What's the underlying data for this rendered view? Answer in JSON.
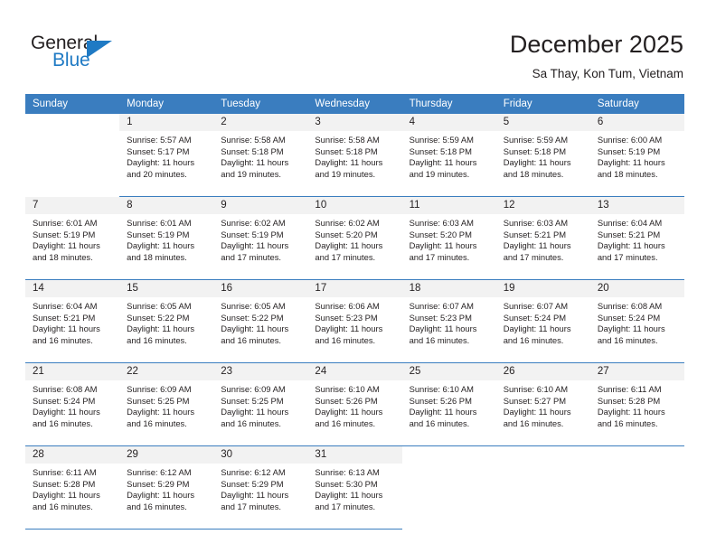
{
  "brand": {
    "name_top": "General",
    "name_bottom": "Blue",
    "accent_color": "#1f7ac4",
    "text_color": "#231f20"
  },
  "header": {
    "title": "December 2025",
    "subtitle": "Sa Thay, Kon Tum, Vietnam"
  },
  "theme": {
    "header_row_bg": "#3a7dbf",
    "daynum_bg": "#f2f2f2",
    "cell_bg": "#ffffff",
    "separator": "#3a7dbf"
  },
  "weekdays": [
    "Sunday",
    "Monday",
    "Tuesday",
    "Wednesday",
    "Thursday",
    "Friday",
    "Saturday"
  ],
  "weeks": [
    {
      "days": [
        {
          "date": "",
          "sunrise": "",
          "sunset": "",
          "daylight_line1": "",
          "daylight_line2": "",
          "empty": true
        },
        {
          "date": "1",
          "sunrise": "Sunrise: 5:57 AM",
          "sunset": "Sunset: 5:17 PM",
          "daylight_line1": "Daylight: 11 hours",
          "daylight_line2": "and 20 minutes.",
          "empty": false
        },
        {
          "date": "2",
          "sunrise": "Sunrise: 5:58 AM",
          "sunset": "Sunset: 5:18 PM",
          "daylight_line1": "Daylight: 11 hours",
          "daylight_line2": "and 19 minutes.",
          "empty": false
        },
        {
          "date": "3",
          "sunrise": "Sunrise: 5:58 AM",
          "sunset": "Sunset: 5:18 PM",
          "daylight_line1": "Daylight: 11 hours",
          "daylight_line2": "and 19 minutes.",
          "empty": false
        },
        {
          "date": "4",
          "sunrise": "Sunrise: 5:59 AM",
          "sunset": "Sunset: 5:18 PM",
          "daylight_line1": "Daylight: 11 hours",
          "daylight_line2": "and 19 minutes.",
          "empty": false
        },
        {
          "date": "5",
          "sunrise": "Sunrise: 5:59 AM",
          "sunset": "Sunset: 5:18 PM",
          "daylight_line1": "Daylight: 11 hours",
          "daylight_line2": "and 18 minutes.",
          "empty": false
        },
        {
          "date": "6",
          "sunrise": "Sunrise: 6:00 AM",
          "sunset": "Sunset: 5:19 PM",
          "daylight_line1": "Daylight: 11 hours",
          "daylight_line2": "and 18 minutes.",
          "empty": false
        }
      ]
    },
    {
      "days": [
        {
          "date": "7",
          "sunrise": "Sunrise: 6:01 AM",
          "sunset": "Sunset: 5:19 PM",
          "daylight_line1": "Daylight: 11 hours",
          "daylight_line2": "and 18 minutes.",
          "empty": false
        },
        {
          "date": "8",
          "sunrise": "Sunrise: 6:01 AM",
          "sunset": "Sunset: 5:19 PM",
          "daylight_line1": "Daylight: 11 hours",
          "daylight_line2": "and 18 minutes.",
          "empty": false
        },
        {
          "date": "9",
          "sunrise": "Sunrise: 6:02 AM",
          "sunset": "Sunset: 5:19 PM",
          "daylight_line1": "Daylight: 11 hours",
          "daylight_line2": "and 17 minutes.",
          "empty": false
        },
        {
          "date": "10",
          "sunrise": "Sunrise: 6:02 AM",
          "sunset": "Sunset: 5:20 PM",
          "daylight_line1": "Daylight: 11 hours",
          "daylight_line2": "and 17 minutes.",
          "empty": false
        },
        {
          "date": "11",
          "sunrise": "Sunrise: 6:03 AM",
          "sunset": "Sunset: 5:20 PM",
          "daylight_line1": "Daylight: 11 hours",
          "daylight_line2": "and 17 minutes.",
          "empty": false
        },
        {
          "date": "12",
          "sunrise": "Sunrise: 6:03 AM",
          "sunset": "Sunset: 5:21 PM",
          "daylight_line1": "Daylight: 11 hours",
          "daylight_line2": "and 17 minutes.",
          "empty": false
        },
        {
          "date": "13",
          "sunrise": "Sunrise: 6:04 AM",
          "sunset": "Sunset: 5:21 PM",
          "daylight_line1": "Daylight: 11 hours",
          "daylight_line2": "and 17 minutes.",
          "empty": false
        }
      ]
    },
    {
      "days": [
        {
          "date": "14",
          "sunrise": "Sunrise: 6:04 AM",
          "sunset": "Sunset: 5:21 PM",
          "daylight_line1": "Daylight: 11 hours",
          "daylight_line2": "and 16 minutes.",
          "empty": false
        },
        {
          "date": "15",
          "sunrise": "Sunrise: 6:05 AM",
          "sunset": "Sunset: 5:22 PM",
          "daylight_line1": "Daylight: 11 hours",
          "daylight_line2": "and 16 minutes.",
          "empty": false
        },
        {
          "date": "16",
          "sunrise": "Sunrise: 6:05 AM",
          "sunset": "Sunset: 5:22 PM",
          "daylight_line1": "Daylight: 11 hours",
          "daylight_line2": "and 16 minutes.",
          "empty": false
        },
        {
          "date": "17",
          "sunrise": "Sunrise: 6:06 AM",
          "sunset": "Sunset: 5:23 PM",
          "daylight_line1": "Daylight: 11 hours",
          "daylight_line2": "and 16 minutes.",
          "empty": false
        },
        {
          "date": "18",
          "sunrise": "Sunrise: 6:07 AM",
          "sunset": "Sunset: 5:23 PM",
          "daylight_line1": "Daylight: 11 hours",
          "daylight_line2": "and 16 minutes.",
          "empty": false
        },
        {
          "date": "19",
          "sunrise": "Sunrise: 6:07 AM",
          "sunset": "Sunset: 5:24 PM",
          "daylight_line1": "Daylight: 11 hours",
          "daylight_line2": "and 16 minutes.",
          "empty": false
        },
        {
          "date": "20",
          "sunrise": "Sunrise: 6:08 AM",
          "sunset": "Sunset: 5:24 PM",
          "daylight_line1": "Daylight: 11 hours",
          "daylight_line2": "and 16 minutes.",
          "empty": false
        }
      ]
    },
    {
      "days": [
        {
          "date": "21",
          "sunrise": "Sunrise: 6:08 AM",
          "sunset": "Sunset: 5:24 PM",
          "daylight_line1": "Daylight: 11 hours",
          "daylight_line2": "and 16 minutes.",
          "empty": false
        },
        {
          "date": "22",
          "sunrise": "Sunrise: 6:09 AM",
          "sunset": "Sunset: 5:25 PM",
          "daylight_line1": "Daylight: 11 hours",
          "daylight_line2": "and 16 minutes.",
          "empty": false
        },
        {
          "date": "23",
          "sunrise": "Sunrise: 6:09 AM",
          "sunset": "Sunset: 5:25 PM",
          "daylight_line1": "Daylight: 11 hours",
          "daylight_line2": "and 16 minutes.",
          "empty": false
        },
        {
          "date": "24",
          "sunrise": "Sunrise: 6:10 AM",
          "sunset": "Sunset: 5:26 PM",
          "daylight_line1": "Daylight: 11 hours",
          "daylight_line2": "and 16 minutes.",
          "empty": false
        },
        {
          "date": "25",
          "sunrise": "Sunrise: 6:10 AM",
          "sunset": "Sunset: 5:26 PM",
          "daylight_line1": "Daylight: 11 hours",
          "daylight_line2": "and 16 minutes.",
          "empty": false
        },
        {
          "date": "26",
          "sunrise": "Sunrise: 6:10 AM",
          "sunset": "Sunset: 5:27 PM",
          "daylight_line1": "Daylight: 11 hours",
          "daylight_line2": "and 16 minutes.",
          "empty": false
        },
        {
          "date": "27",
          "sunrise": "Sunrise: 6:11 AM",
          "sunset": "Sunset: 5:28 PM",
          "daylight_line1": "Daylight: 11 hours",
          "daylight_line2": "and 16 minutes.",
          "empty": false
        }
      ]
    },
    {
      "days": [
        {
          "date": "28",
          "sunrise": "Sunrise: 6:11 AM",
          "sunset": "Sunset: 5:28 PM",
          "daylight_line1": "Daylight: 11 hours",
          "daylight_line2": "and 16 minutes.",
          "empty": false
        },
        {
          "date": "29",
          "sunrise": "Sunrise: 6:12 AM",
          "sunset": "Sunset: 5:29 PM",
          "daylight_line1": "Daylight: 11 hours",
          "daylight_line2": "and 16 minutes.",
          "empty": false
        },
        {
          "date": "30",
          "sunrise": "Sunrise: 6:12 AM",
          "sunset": "Sunset: 5:29 PM",
          "daylight_line1": "Daylight: 11 hours",
          "daylight_line2": "and 17 minutes.",
          "empty": false
        },
        {
          "date": "31",
          "sunrise": "Sunrise: 6:13 AM",
          "sunset": "Sunset: 5:30 PM",
          "daylight_line1": "Daylight: 11 hours",
          "daylight_line2": "and 17 minutes.",
          "empty": false
        },
        {
          "date": "",
          "sunrise": "",
          "sunset": "",
          "daylight_line1": "",
          "daylight_line2": "",
          "empty": true
        },
        {
          "date": "",
          "sunrise": "",
          "sunset": "",
          "daylight_line1": "",
          "daylight_line2": "",
          "empty": true
        },
        {
          "date": "",
          "sunrise": "",
          "sunset": "",
          "daylight_line1": "",
          "daylight_line2": "",
          "empty": true
        }
      ]
    }
  ]
}
